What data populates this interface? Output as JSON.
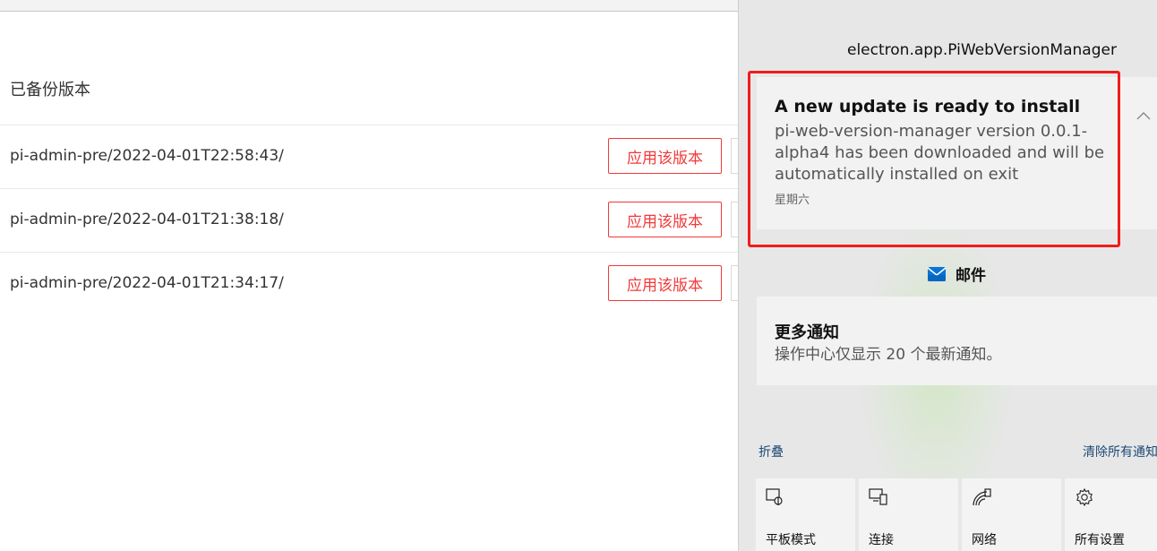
{
  "app": {
    "section_title": "已备份版本",
    "rows": [
      {
        "name": "pi-admin-pre/2022-04-01T22:58:43/",
        "apply_label": "应用该版本"
      },
      {
        "name": "pi-admin-pre/2022-04-01T21:38:18/",
        "apply_label": "应用该版本"
      },
      {
        "name": "pi-admin-pre/2022-04-01T21:34:17/",
        "apply_label": "应用该版本"
      }
    ]
  },
  "action_center": {
    "app_header": "electron.app.PiWebVersionManager",
    "toast": {
      "title": "A new update is ready to install",
      "body": "pi-web-version-manager version 0.0.1-alpha4 has been downloaded and will be automatically installed on exit",
      "time": "星期六"
    },
    "mail": {
      "label": "邮件",
      "icon": "mail-icon"
    },
    "more_notifications": {
      "title": "更多通知",
      "description": "操作中心仅显示 20 个最新通知。"
    },
    "collapse_label": "折叠",
    "clear_all_label": "清除所有通知",
    "quick_actions": [
      {
        "label": "平板模式",
        "icon": "tablet-mode-icon"
      },
      {
        "label": "连接",
        "icon": "connect-icon"
      },
      {
        "label": "网络",
        "icon": "network-icon"
      },
      {
        "label": "所有设置",
        "icon": "settings-gear-icon"
      }
    ]
  },
  "colors": {
    "accent_red": "#f2393a",
    "highlight_red": "#f01c1c",
    "link_blue": "#1d4a77",
    "mail_blue": "#0a74d6"
  }
}
